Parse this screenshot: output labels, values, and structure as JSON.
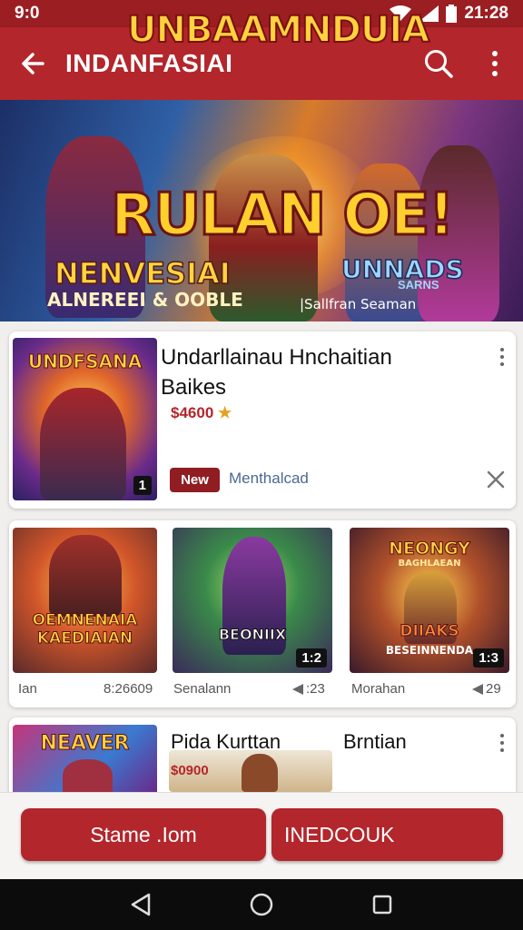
{
  "status_bar": {
    "time_left": "9:0",
    "time_right": "21:28"
  },
  "app_bar": {
    "title": "INDANFASIAI",
    "icons": [
      "back-arrow-icon",
      "search-icon",
      "more-vert-icon"
    ]
  },
  "banner": {
    "top_text": "UNBAAMNDUIA",
    "main_text": "RULAN OE!",
    "left_text": "NENVESIAI",
    "left_sub": "ALNEREEI & OOBLE",
    "right_text": "UNNADS",
    "right_small": "SARNS",
    "right_sub": "|Sallfran Seaman"
  },
  "featured": {
    "thumb_title": "UNDFSANA",
    "thumb_badge": "1",
    "title": "Undarllainau Hnchaitian Baikes",
    "price": "$4600",
    "tag": "New",
    "tag_text": "Menthalcad"
  },
  "grid": [
    {
      "thumb_title": "OEMNENAIA KAEDIAIAN",
      "caption": "Ian",
      "value": "8:26609"
    },
    {
      "thumb_title": "BEONIIX",
      "badge": "1:2",
      "caption": "Senalann",
      "value": ":23"
    },
    {
      "thumb_title": "NEONGY",
      "thumb_sub": "BAGHLAEAN",
      "thumb_mid": "DIIAKS",
      "thumb_bottom": "BESEINNENDA",
      "badge": "1:3",
      "caption": "Morahan",
      "value": "29"
    }
  ],
  "row3": {
    "thumb_title": "NEAVER",
    "title_1": "Pida Kurttan",
    "price": "$0900",
    "title_2": "Brntian"
  },
  "buttons": {
    "left": "Stame .Iom",
    "right": "INEDCOUK"
  },
  "colors": {
    "primary": "#b3262b",
    "dark": "#9b1e22",
    "star": "#e3a321"
  }
}
